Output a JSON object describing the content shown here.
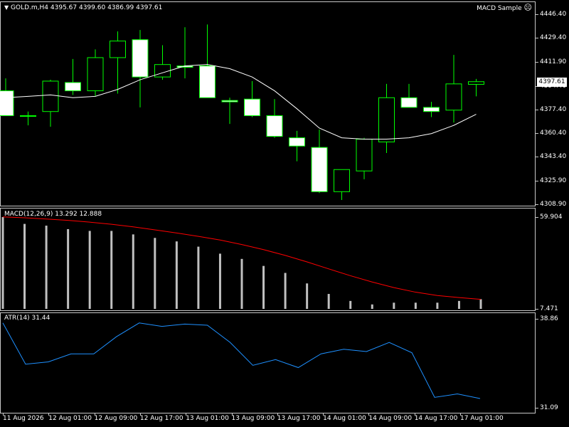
{
  "main": {
    "symbol": "GOLD.m,H4",
    "ohlc": "4395.67 4399.60 4386.99 4397.61",
    "expert": "MACD Sample",
    "expert_icon": "sad-face-icon",
    "menu_icon": "triangle-down-icon",
    "current_price": "4397.61",
    "ticks": [
      "4446.40",
      "4429.40",
      "4411.90",
      "4394.40",
      "4377.40",
      "4360.40",
      "4343.40",
      "4325.90",
      "4308.90"
    ]
  },
  "macd": {
    "title": "MACD(12,26,9) 13.292 12.888",
    "ticks": [
      "59.904",
      "7.471"
    ],
    "histogram": [
      59.9,
      56,
      55,
      53,
      52,
      52,
      50,
      48,
      46,
      43,
      39,
      36,
      32,
      28,
      22,
      16,
      12,
      10,
      11,
      11,
      11,
      12,
      13
    ],
    "signal": [
      60.0,
      59.5,
      58.8,
      58,
      57,
      55.8,
      54.3,
      52.6,
      50.8,
      48.9,
      46.8,
      44.2,
      41.3,
      38,
      34.3,
      30.3,
      26.4,
      22.8,
      19.6,
      17.0,
      15.1,
      13.9,
      12.9
    ]
  },
  "atr": {
    "title": "ATR(14) 31.44",
    "ticks": [
      "38.86",
      "31.09"
    ],
    "values": [
      38.5,
      34.9,
      35.1,
      35.8,
      35.8,
      37.3,
      38.5,
      38.2,
      38.4,
      38.3,
      36.8,
      34.8,
      35.3,
      34.6,
      35.8,
      36.2,
      36.0,
      36.8,
      35.9,
      32.0,
      32.3,
      31.9
    ]
  },
  "chart_data": {
    "type": "candlestick",
    "title": "GOLD.m,H4",
    "ylim": [
      4308.9,
      4446.4
    ],
    "colors": {
      "up_fill": "#000000",
      "down_fill": "#ffffff",
      "wick": "#00ff00",
      "ma": "#ffffff",
      "signal": "#ff0000",
      "histogram": "#c0c0c0",
      "atr": "#1e90ff"
    },
    "x_labels": [
      "11 Aug 2026",
      "12 Aug 01:00",
      "12 Aug 09:00",
      "12 Aug 17:00",
      "13 Aug 01:00",
      "13 Aug 09:00",
      "13 Aug 17:00",
      "14 Aug 01:00",
      "14 Aug 09:00",
      "14 Aug 17:00",
      "17 Aug 01:00"
    ],
    "candles": [
      {
        "o": 4391.0,
        "h": 4400.0,
        "l": 4374.5,
        "c": 4373.0
      },
      {
        "o": 4373.0,
        "h": 4376.0,
        "l": 4366.0,
        "c": 4373.0
      },
      {
        "o": 4376.0,
        "h": 4399.0,
        "l": 4365.0,
        "c": 4398.0
      },
      {
        "o": 4397.0,
        "h": 4414.0,
        "l": 4388.0,
        "c": 4391.0
      },
      {
        "o": 4391.0,
        "h": 4421.0,
        "l": 4387.0,
        "c": 4415.0
      },
      {
        "o": 4415.0,
        "h": 4434.0,
        "l": 4389.0,
        "c": 4427.0
      },
      {
        "o": 4428.0,
        "h": 4435.0,
        "l": 4379.0,
        "c": 4401.0
      },
      {
        "o": 4401.0,
        "h": 4424.0,
        "l": 4399.0,
        "c": 4410.0
      },
      {
        "o": 4409.0,
        "h": 4437.0,
        "l": 4400.0,
        "c": 4408.0
      },
      {
        "o": 4409.0,
        "h": 4439.0,
        "l": 4402.0,
        "c": 4386.0
      },
      {
        "o": 4384.0,
        "h": 4386.0,
        "l": 4367.0,
        "c": 4383.0
      },
      {
        "o": 4385.0,
        "h": 4398.0,
        "l": 4372.0,
        "c": 4373.0
      },
      {
        "o": 4373.0,
        "h": 4385.0,
        "l": 4357.0,
        "c": 4358.0
      },
      {
        "o": 4357.0,
        "h": 4362.0,
        "l": 4340.0,
        "c": 4351.0
      },
      {
        "o": 4350.0,
        "h": 4363.0,
        "l": 4317.0,
        "c": 4318.0
      },
      {
        "o": 4318.0,
        "h": 4334.0,
        "l": 4312.0,
        "c": 4334.0
      },
      {
        "o": 4333.0,
        "h": 4357.0,
        "l": 4327.0,
        "c": 4356.0
      },
      {
        "o": 4354.0,
        "h": 4396.0,
        "l": 4346.0,
        "c": 4386.0
      },
      {
        "o": 4386.0,
        "h": 4396.0,
        "l": 4379.0,
        "c": 4379.0
      },
      {
        "o": 4379.0,
        "h": 4383.0,
        "l": 4372.0,
        "c": 4376.0
      },
      {
        "o": 4377.0,
        "h": 4417.0,
        "l": 4368.0,
        "c": 4396.0
      },
      {
        "o": 4395.67,
        "h": 4399.6,
        "l": 4386.99,
        "c": 4397.61
      }
    ],
    "ma": [
      4386,
      4387,
      4388,
      4386,
      4387,
      4392,
      4399,
      4404,
      4409,
      4410,
      4407,
      4401,
      4391,
      4378,
      4364,
      4357,
      4356,
      4356,
      4357,
      4360,
      4366,
      4374
    ]
  }
}
